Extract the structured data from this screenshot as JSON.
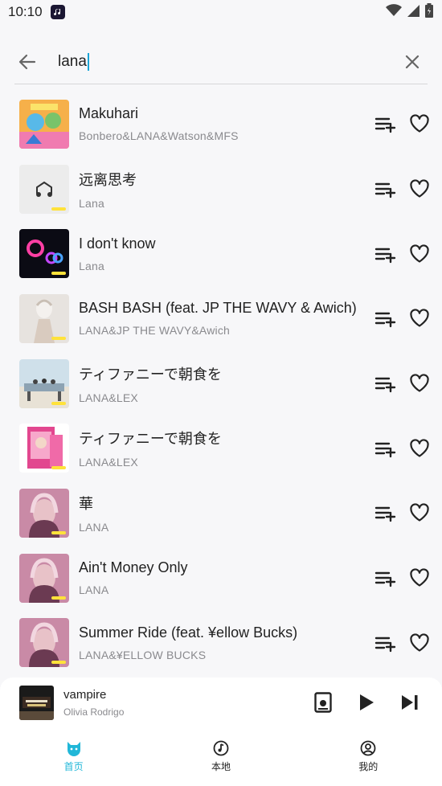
{
  "status_bar": {
    "time": "10:10"
  },
  "search": {
    "query": "lana"
  },
  "songs": [
    {
      "title": "Makuhari",
      "artist": "Bonbero&LANA&Watson&MFS"
    },
    {
      "title": "远离思考",
      "artist": "Lana"
    },
    {
      "title": "I don't know",
      "artist": "Lana"
    },
    {
      "title": "BASH BASH (feat. JP THE WAVY & Awich)",
      "artist": "LANA&JP THE WAVY&Awich"
    },
    {
      "title": "ティファニーで朝食を",
      "artist": "LANA&LEX"
    },
    {
      "title": "ティファニーで朝食を",
      "artist": "LANA&LEX"
    },
    {
      "title": "華",
      "artist": "LANA"
    },
    {
      "title": "Ain't Money Only",
      "artist": "LANA"
    },
    {
      "title": "Summer Ride (feat. ¥ellow Bucks)",
      "artist": "LANA&¥ELLOW BUCKS"
    }
  ],
  "now_playing": {
    "title": "vampire",
    "artist": "Olivia Rodrigo"
  },
  "nav": [
    {
      "label": "首页",
      "icon": "cat-icon",
      "active": true
    },
    {
      "label": "本地",
      "icon": "music-note-icon",
      "active": false
    },
    {
      "label": "我的",
      "icon": "user-icon",
      "active": false
    }
  ],
  "colors": {
    "accent": "#21b7d8",
    "caret": "#19a4d6",
    "badge": "#ffe23a"
  }
}
